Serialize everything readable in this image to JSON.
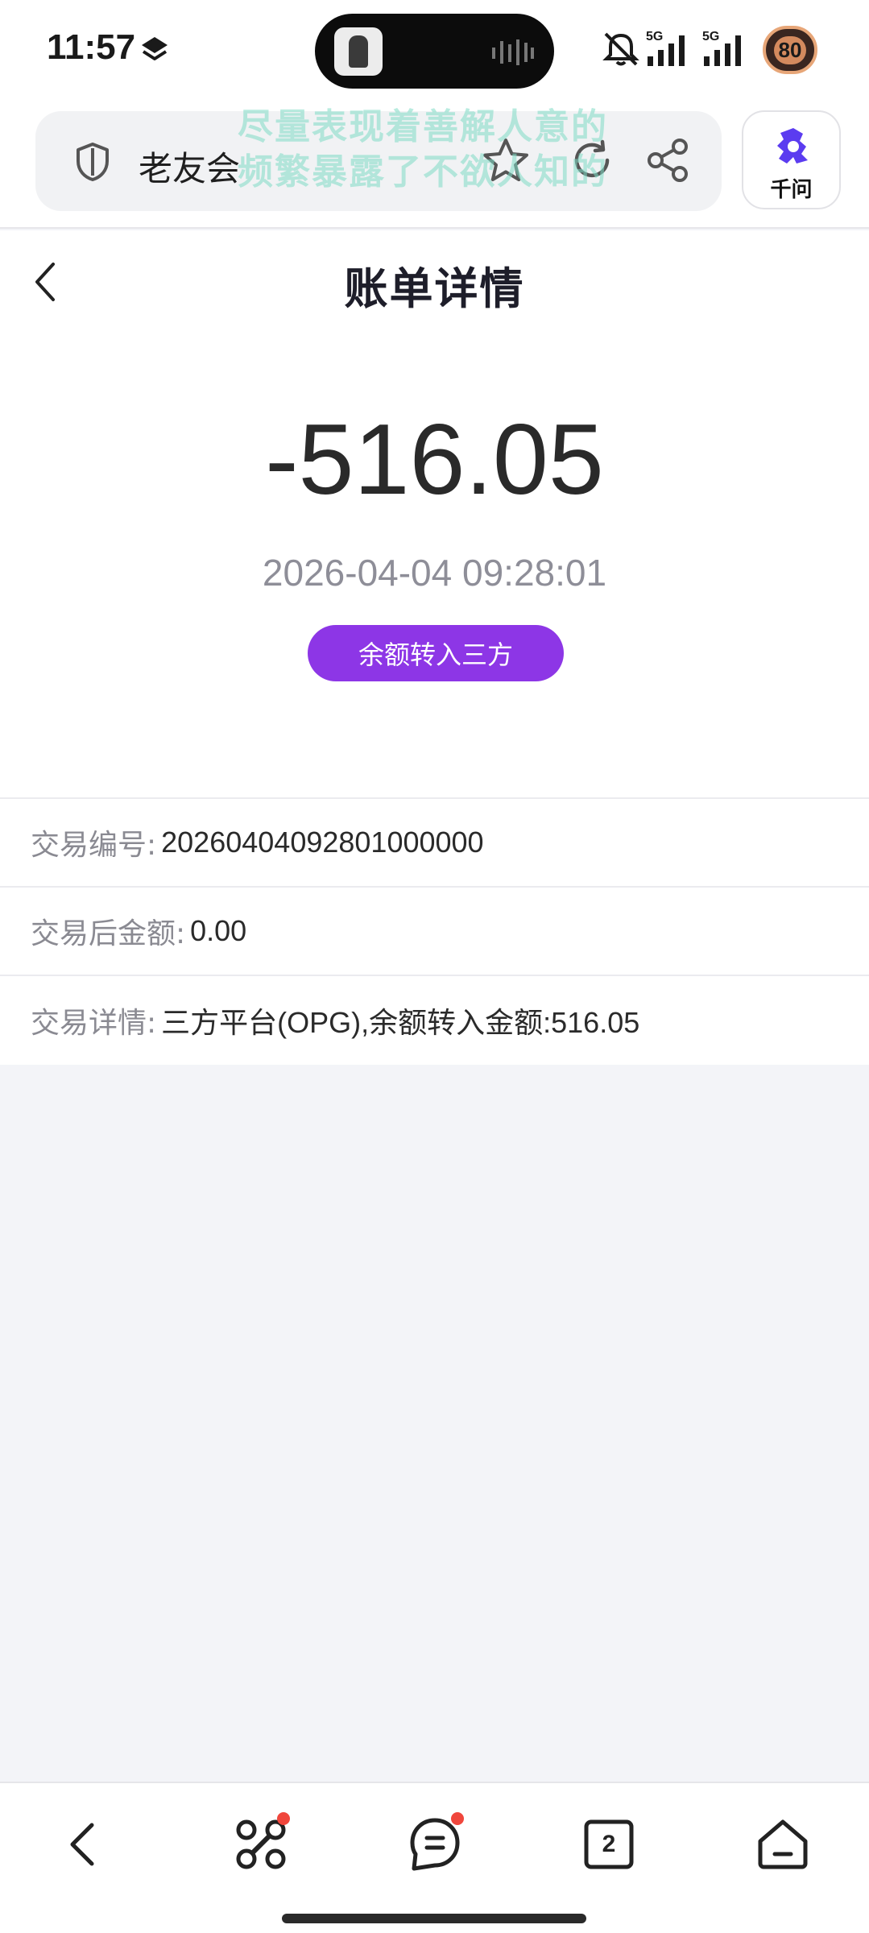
{
  "status_bar": {
    "time": "11:57",
    "network_1": "5G",
    "network_2": "5G",
    "battery": "80",
    "icons": [
      "layers-icon",
      "mute-icon",
      "signal-icon",
      "signal-icon",
      "battery-icon"
    ]
  },
  "browser": {
    "page_title": "老友会",
    "overlay_line_1": "尽量表现着善解人意的",
    "overlay_line_2": "频繁暴露了不欲人知的",
    "assistant_label": "千问",
    "icons": [
      "shield-icon",
      "star-icon",
      "reload-icon",
      "share-icon",
      "qianwen-logo-icon"
    ]
  },
  "header": {
    "title": "账单详情",
    "back_icon": "chevron-left-icon"
  },
  "summary": {
    "amount": "-516.05",
    "datetime": "2026-04-04 09:28:01",
    "type_badge": "余额转入三方"
  },
  "details": [
    {
      "label": "交易编号:",
      "value": "20260404092801000000"
    },
    {
      "label": "交易后金额:",
      "value": "0.00"
    },
    {
      "label": "交易详情:",
      "value": "三方平台(OPG),余额转入金额:516.05"
    }
  ],
  "bottom_nav": {
    "tab_count": "2",
    "icons": [
      "back-icon",
      "ai-assistant-icon",
      "menu-icon",
      "tabs-icon",
      "home-icon"
    ]
  },
  "colors": {
    "accent_purple": "#8d36e6",
    "background": "#f3f4f8",
    "notification_red": "#f0463c"
  }
}
